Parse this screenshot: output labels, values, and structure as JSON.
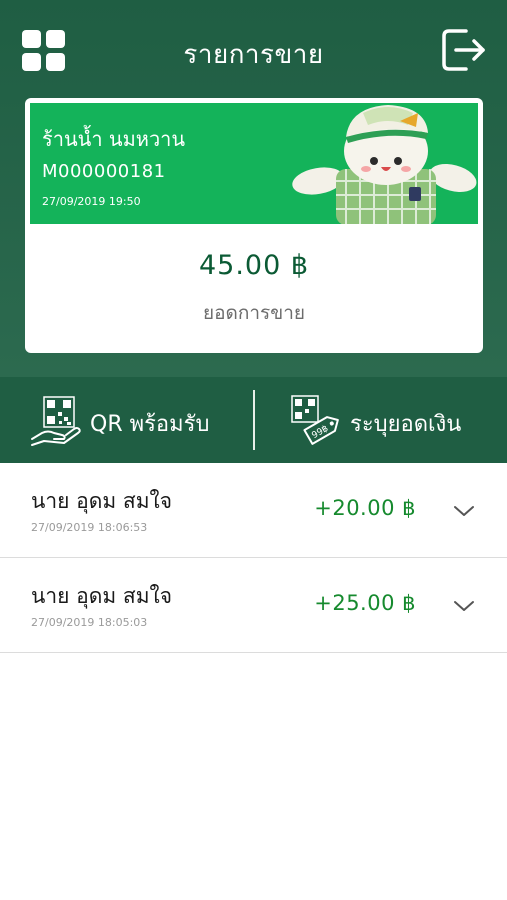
{
  "header": {
    "title": "รายการขาย",
    "menu_icon": "grid-icon",
    "logout_icon": "logout-icon"
  },
  "card": {
    "shop_name": "ร้านน้ำ นมหวาน",
    "merchant_id": "M000000181",
    "datetime": "27/09/2019 19:50",
    "total_amount": "45.00 ฿",
    "total_label": "ยอดการขาย"
  },
  "actions": {
    "qr_label": "QR พร้อมรับ",
    "qr_icon": "qr-hand-icon",
    "amount_label": "ระบุยอดเงิน",
    "amount_icon": "qr-price-tag-icon"
  },
  "transactions": [
    {
      "name": "นาย อุดม สมใจ",
      "time": "27/09/2019 18:06:53",
      "amount": "+20.00 ฿"
    },
    {
      "name": "นาย อุดม สมใจ",
      "time": "27/09/2019 18:05:03",
      "amount": "+25.00 ฿"
    }
  ],
  "colors": {
    "header_bg": "#1f5e43",
    "banner_green": "#14b35a",
    "amount_green": "#168a2e",
    "total_green": "#0b5a34"
  }
}
